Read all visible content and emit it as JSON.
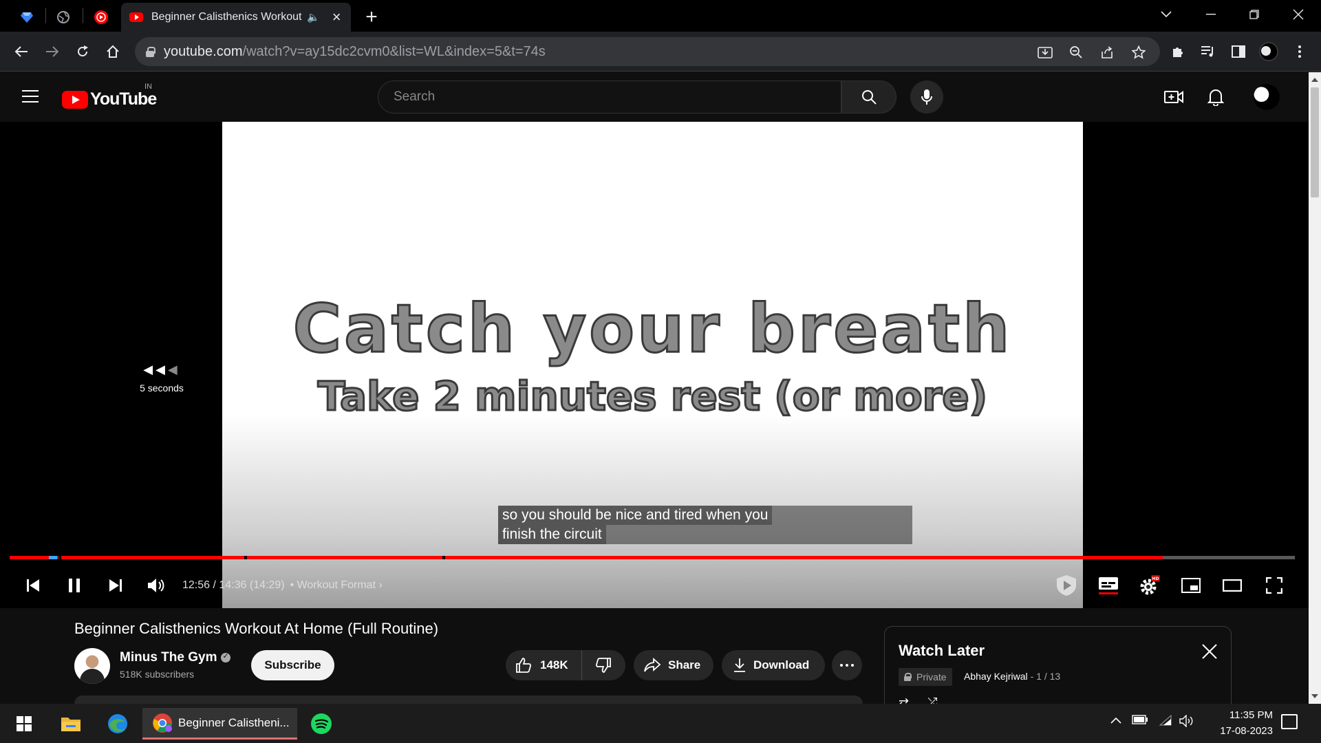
{
  "browser": {
    "active_tab_title": "Beginner Calisthenics Workout At Home (Full Routine)",
    "url_host": "youtube.com",
    "url_path": "/watch?v=ay15dc2cvm0&list=WL&index=5&t=74s"
  },
  "youtube": {
    "logo_text": "YouTube",
    "country_code": "IN",
    "search_placeholder": "Search"
  },
  "player": {
    "overlay_title": "Catch your breath",
    "overlay_subtitle": "Take 2 minutes rest (or more)",
    "seek_hint": "5 seconds",
    "caption_line1": "so you should be nice and tired when you",
    "caption_line2": "finish the circuit",
    "time_display": "12:56 / 14:36 (14:29)",
    "chapter_label": "• Workout Format",
    "progress_fraction": 0.897,
    "hd_badge": "HD"
  },
  "video": {
    "title": "Beginner Calisthenics Workout At Home (Full Routine)",
    "channel_name": "Minus The Gym",
    "subscribers": "518K subscribers",
    "subscribe_label": "Subscribe",
    "likes": "148K",
    "share_label": "Share",
    "download_label": "Download"
  },
  "playlist": {
    "title": "Watch Later",
    "privacy": "Private",
    "owner": "Abhay Kejriwal",
    "position": "- 1 / 13"
  },
  "taskbar": {
    "chrome_window_label": "Beginner Calistheni...",
    "time": "11:35 PM",
    "date": "17-08-2023"
  },
  "colors": {
    "youtube_red": "#ff0000",
    "page_background": "#0f0f0f",
    "browser_toolbar": "#202124"
  }
}
